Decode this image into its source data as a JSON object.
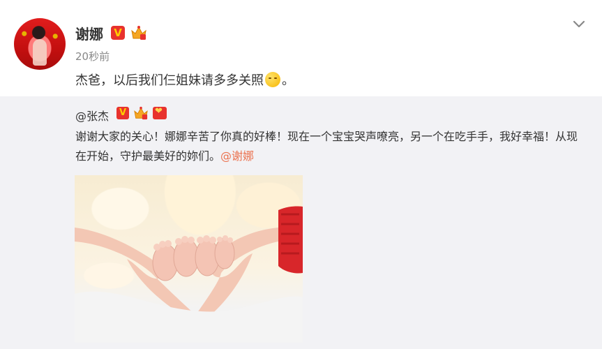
{
  "post": {
    "username": "谢娜",
    "verified_badge": "V",
    "time": "20秒前",
    "text_before": "杰爸，以后我们仨姐妹请多多关照",
    "text_after": "。",
    "emoji": "hug-emoji"
  },
  "repost": {
    "username": "@张杰",
    "verified_badge": "V",
    "text": "谢谢大家的关心！娜娜辛苦了你真的好棒！现在一个宝宝哭声嘹亮，另一个在吃手手，我好幸福！从现在开始，守护最美好的妳们。",
    "mention": "@谢娜"
  },
  "colors": {
    "accent": "#eb7350",
    "badge_red": "#e8322d",
    "badge_gold": "#ffcc00",
    "repost_bg": "#f2f2f5"
  }
}
